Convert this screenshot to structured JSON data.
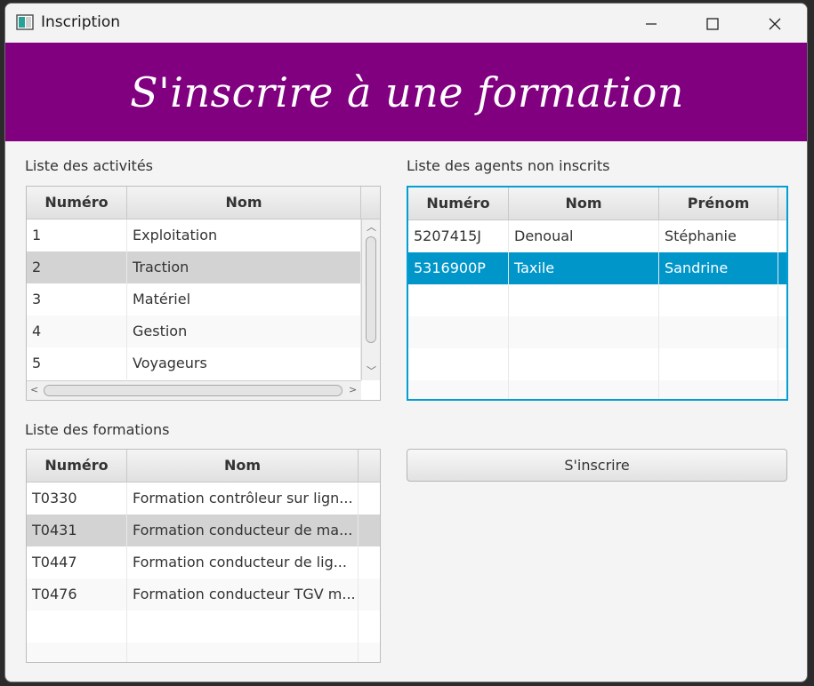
{
  "window": {
    "title": "Inscription"
  },
  "banner": {
    "title": "S'inscrire à une formation"
  },
  "activities": {
    "label": "Liste des activités",
    "columns": [
      "Numéro",
      "Nom"
    ],
    "rows": [
      [
        "1",
        "Exploitation"
      ],
      [
        "2",
        "Traction"
      ],
      [
        "3",
        "Matériel"
      ],
      [
        "4",
        "Gestion"
      ],
      [
        "5",
        "Voyageurs"
      ]
    ],
    "selected_row": 1
  },
  "agents": {
    "label": "Liste des agents non inscrits",
    "columns": [
      "Numéro",
      "Nom",
      "Prénom"
    ],
    "rows": [
      [
        "5207415J",
        "Denoual",
        "Stéphanie"
      ],
      [
        "5316900P",
        "Taxile",
        "Sandrine"
      ]
    ],
    "selected_row": 1
  },
  "formations": {
    "label": "Liste des formations",
    "columns": [
      "Numéro",
      "Nom"
    ],
    "rows": [
      [
        "T0330",
        "Formation contrôleur sur lign..."
      ],
      [
        "T0431",
        "Formation conducteur de ma..."
      ],
      [
        "T0447",
        "Formation conducteur de lig..."
      ],
      [
        "T0476",
        "Formation conducteur TGV m..."
      ]
    ],
    "selected_row": 1
  },
  "actions": {
    "register_label": "S'inscrire"
  },
  "colors": {
    "banner": "#800080",
    "selection": "#0096c9",
    "focus_border": "#039ed3"
  },
  "icons": [
    "app-icon",
    "minimize-icon",
    "maximize-icon",
    "close-icon",
    "scroll-up-icon",
    "scroll-down-icon",
    "scroll-left-icon",
    "scroll-right-icon"
  ]
}
